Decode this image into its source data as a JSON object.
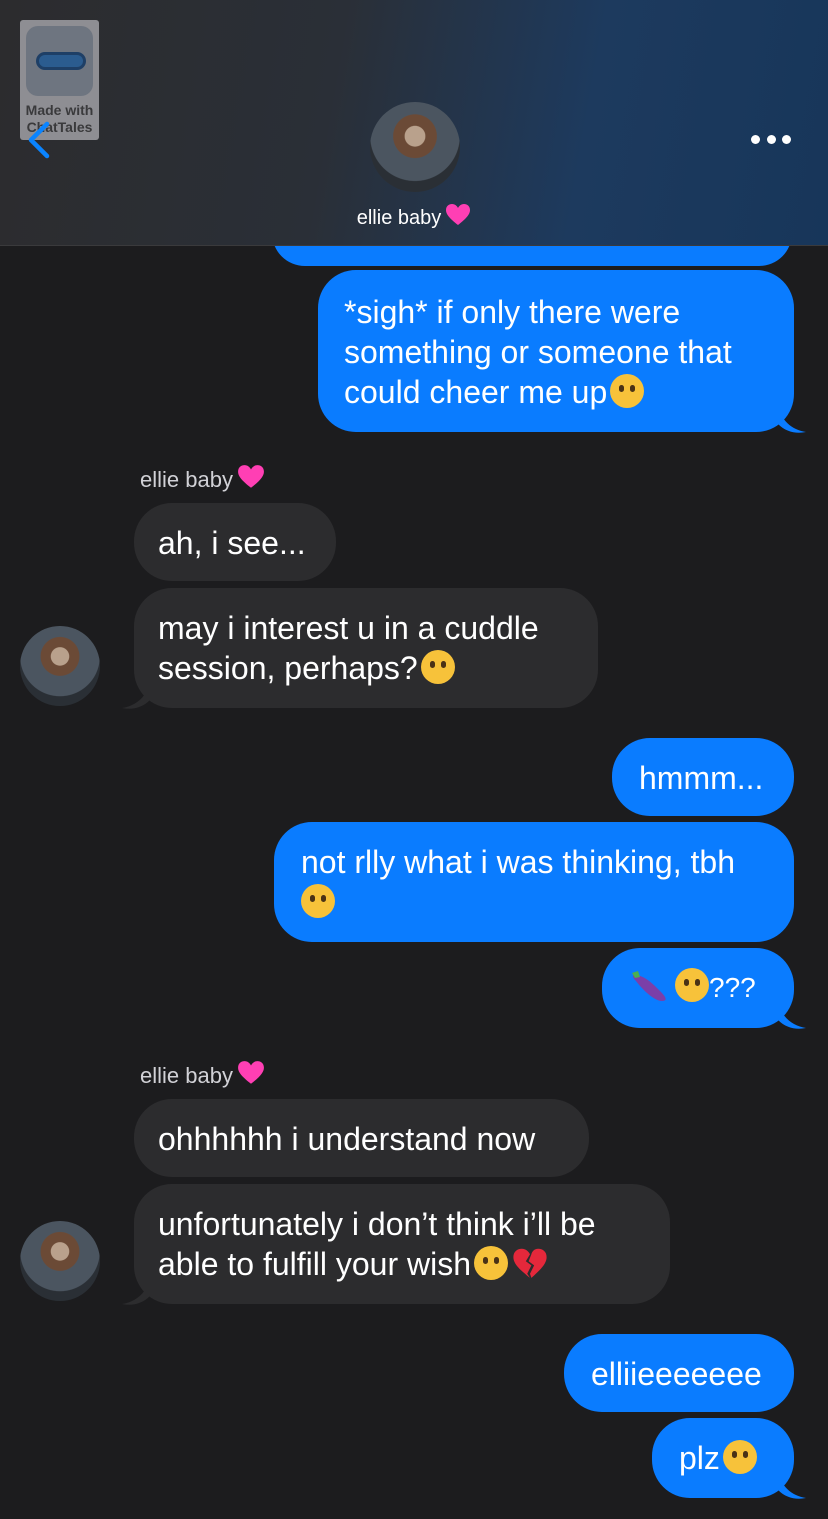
{
  "watermark": {
    "line1": "Made with",
    "line2": "ChatTales"
  },
  "contact": {
    "name": "ellie baby"
  },
  "messages": {
    "m1": "*sigh* if only there were something or someone that could cheer me up",
    "sender1": "ellie baby",
    "m2": "ah, i see...",
    "m3": "may i interest u in a cuddle session, perhaps?",
    "m4": "hmmm...",
    "m5_line1": "not rlly what i was thinking, tbh",
    "m6": "???",
    "sender2": "ellie baby",
    "m7": "ohhhhhh i understand now",
    "m8": "unfortunately i don’t think i’ll be able to fulfill your wish",
    "m9": "elliieeeeeee",
    "m10": "plz"
  },
  "colors": {
    "sent_bubble": "#0a7cff",
    "received_bubble": "#2c2c2e",
    "background": "#1c1c1e"
  },
  "icons": [
    "back-chevron-icon",
    "more-dots-icon",
    "pink-heart-icon",
    "face-with-hands-emoji",
    "thinking-face-emoji",
    "upside-down-face-emoji",
    "eggplant-emoji",
    "pleading-face-emoji",
    "pensive-face-emoji",
    "broken-heart-emoji"
  ]
}
